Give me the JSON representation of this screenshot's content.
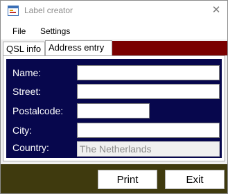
{
  "window": {
    "title": "Label creator",
    "close_glyph": "✕"
  },
  "menu": {
    "items": [
      {
        "label": "File"
      },
      {
        "label": "Settings"
      }
    ]
  },
  "tabs": [
    {
      "label": "QSL info"
    },
    {
      "label": "Address entry",
      "active": true
    }
  ],
  "form": {
    "fields": [
      {
        "label": "Name:",
        "value": ""
      },
      {
        "label": "Street:",
        "value": ""
      },
      {
        "label": "Postalcode:",
        "value": ""
      },
      {
        "label": "City:",
        "value": ""
      },
      {
        "label": "Country:",
        "value": "The Netherlands",
        "disabled": true
      }
    ]
  },
  "buttons": {
    "print": "Print",
    "exit": "Exit"
  },
  "colors": {
    "panel_background": "#07074d",
    "tab_strip_accent": "#7a0000",
    "bottom_bar": "#3f3a0e"
  },
  "icons": {
    "app": "app-form-icon",
    "close": "close-icon"
  }
}
